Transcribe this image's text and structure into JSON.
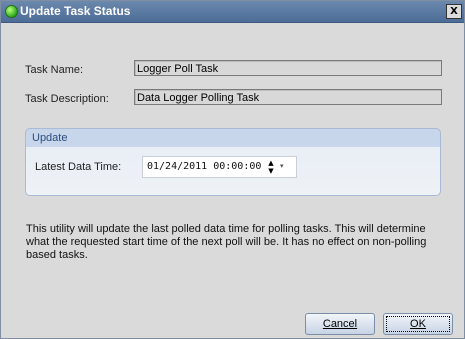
{
  "window": {
    "title": "Update Task Status",
    "close_label": "X"
  },
  "task": {
    "name_label": "Task Name:",
    "name_value": "Logger Poll Task",
    "desc_label": "Task Description:",
    "desc_value": "Data Logger Polling Task"
  },
  "update_group": {
    "title": "Update",
    "latest_label": "Latest Data Time:",
    "latest_value": "01/24/2011  00:00:00",
    "spin_up": "▲",
    "spin_down": "▼",
    "dropdown": "▾"
  },
  "description": "This utility will update the last polled data time for polling tasks.  This will determine what the requested start time of the next poll will be.  It has no effect on non-polling based tasks.",
  "buttons": {
    "cancel_label": "Cancel",
    "ok_label": "OK"
  }
}
